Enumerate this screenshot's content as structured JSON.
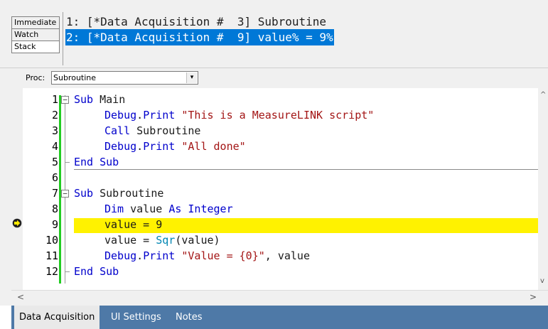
{
  "debug_tabs": [
    "Immediate",
    "Watch",
    "Stack"
  ],
  "call_stack": [
    "1: [*Data Acquisition #  3] Subroutine",
    "2: [*Data Acquisition #  9] value% = 9%"
  ],
  "proc": {
    "label": "Proc:",
    "value": "Subroutine",
    "dropdown_glyph": "▾"
  },
  "code": {
    "line_numbers": [
      "1",
      "2",
      "3",
      "4",
      "5",
      "6",
      "7",
      "8",
      "9",
      "10",
      "11",
      "12"
    ],
    "l1": {
      "kw1": "Sub",
      "rest": " Main"
    },
    "l2": {
      "obj": "Debug",
      "dot": ".",
      "method": "Print",
      "str": "\"This is a MeasureLINK script\""
    },
    "l3": {
      "kw": "Call",
      "rest": " Subroutine"
    },
    "l4": {
      "obj": "Debug",
      "dot": ".",
      "method": "Print",
      "str": "\"All done\""
    },
    "l5": {
      "kw": "End Sub"
    },
    "l7": {
      "kw": "Sub",
      "rest": " Subroutine"
    },
    "l8": {
      "kw1": "Dim",
      "mid": " value ",
      "kw2": "As Integer"
    },
    "l9": {
      "text": "value = 9"
    },
    "l10": {
      "pre": "value = ",
      "fn": "Sqr",
      "post": "(value)"
    },
    "l11": {
      "obj": "Debug",
      "dot": ".",
      "method": "Print",
      "str": "\"Value = {0}\"",
      "post": ", value"
    },
    "l12": {
      "kw": "End Sub"
    }
  },
  "bottom_tabs": [
    "Data Acquisition",
    "UI Settings",
    "Notes"
  ],
  "colors": {
    "highlight": "#fff200",
    "selection": "#0078d7",
    "tab_strip": "#4e79a7",
    "exec_bar": "#22cc22"
  },
  "icons": {
    "execution_point": "arrow-icon",
    "scroll_left": "chevron-left-icon",
    "scroll_right": "chevron-right-icon"
  }
}
